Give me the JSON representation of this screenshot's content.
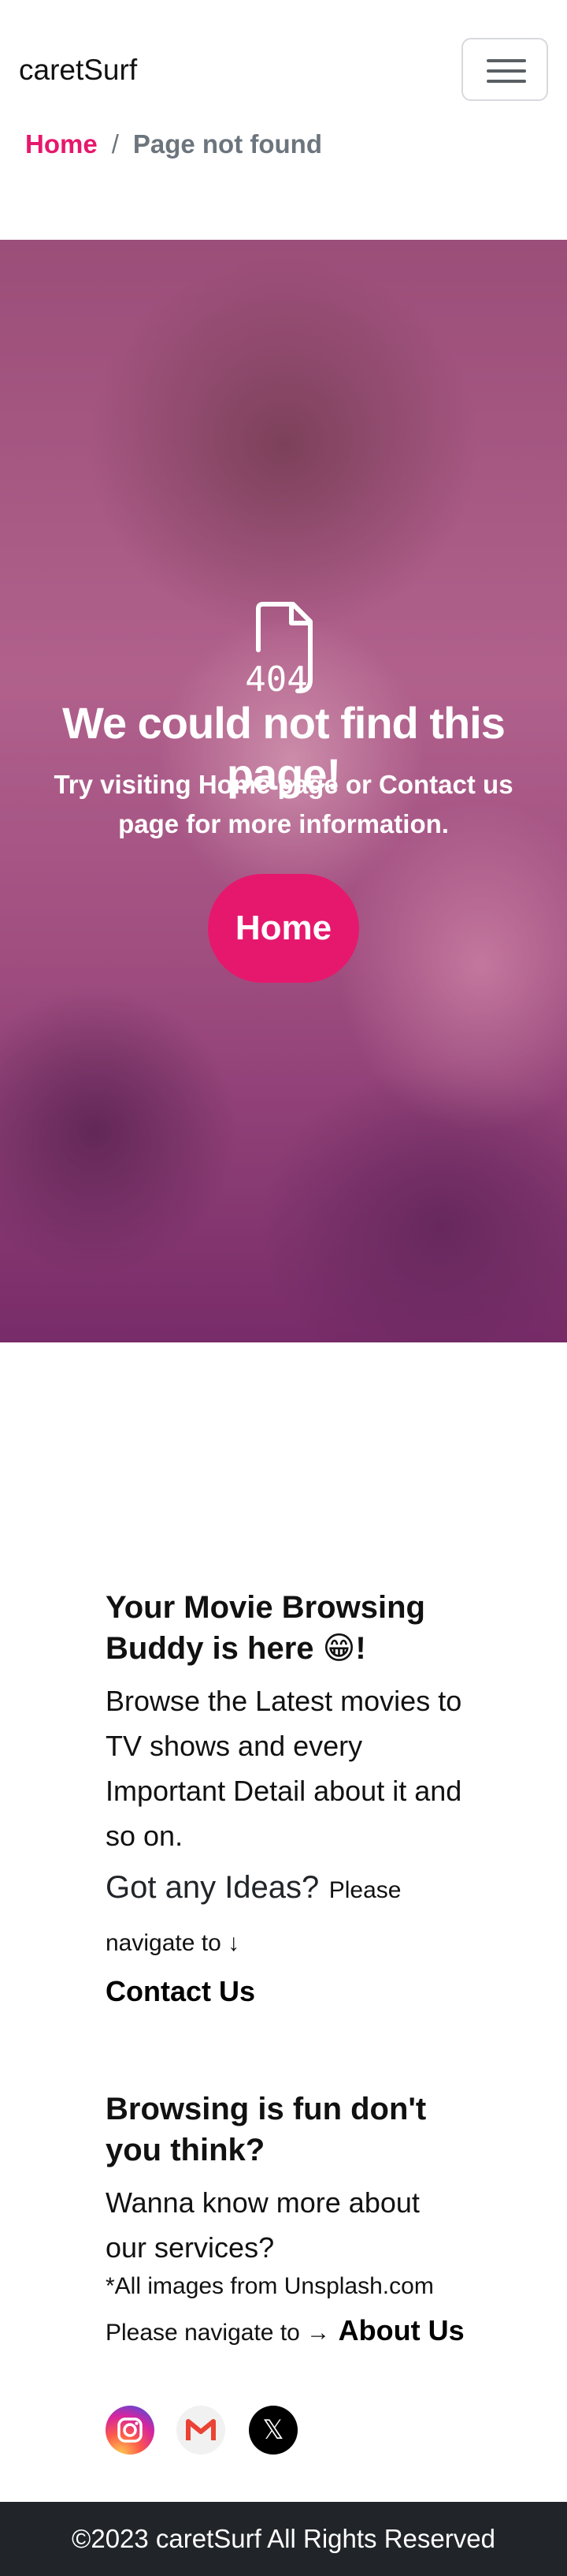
{
  "navbar": {
    "brand": "caretSurf",
    "toggle_icon": "hamburger-icon"
  },
  "breadcrumb": {
    "home": "Home",
    "separator": "/",
    "current": "Page not found"
  },
  "hero": {
    "icon": "file-404-icon",
    "icon_text": "404",
    "title": "We could not find this page!",
    "subtitle": "Try visiting Home page or Contact us page for more information.",
    "button_label": "Home"
  },
  "footer": {
    "about": {
      "heading": "Your Movie Browsing Buddy is here 😁!",
      "description": "Browse the Latest movies to TV shows and every Important Detail about it and so on.",
      "ideas_heading": "Got any Ideas?",
      "ideas_note": "Please navigate to ↓",
      "contact_link": "Contact Us"
    },
    "services": {
      "heading": "Browsing is fun don't you think?",
      "description": "Wanna know more about our services?",
      "credit": "*All images from Unsplash.com",
      "navigate_text": "Please navigate to →",
      "about_link": "About Us"
    },
    "socials": [
      {
        "icon": "instagram-icon"
      },
      {
        "icon": "gmail-icon"
      },
      {
        "icon": "x-icon",
        "glyph": "𝕏"
      }
    ],
    "copyright": "©2023 caretSurf All Rights Reserved"
  },
  "colors": {
    "accent": "#e6186d",
    "footer_bar": "#212529",
    "muted": "#6c757d"
  }
}
